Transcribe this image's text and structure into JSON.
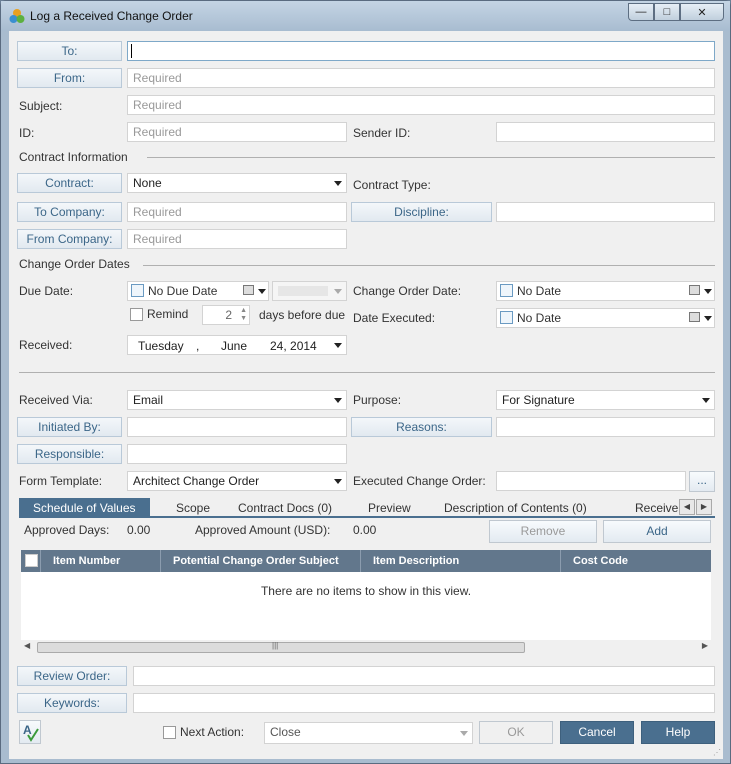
{
  "window": {
    "title": "Log a Received Change Order",
    "minimize": "—",
    "maximize": "□",
    "close": "✕"
  },
  "fields": {
    "to": {
      "label": "To:",
      "value": ""
    },
    "from": {
      "label": "From:",
      "placeholder": "Required"
    },
    "subject": {
      "label": "Subject:",
      "placeholder": "Required"
    },
    "id": {
      "label": "ID:",
      "placeholder": "Required"
    },
    "sender_id": {
      "label": "Sender ID:",
      "value": ""
    }
  },
  "contract_info": {
    "header": "Contract Information",
    "contract_label": "Contract:",
    "contract_value": "None",
    "contract_type_label": "Contract Type:",
    "to_company_label": "To Company:",
    "to_company_placeholder": "Required",
    "discipline_label": "Discipline:",
    "from_company_label": "From Company:",
    "from_company_placeholder": "Required"
  },
  "change_order_dates": {
    "header": "Change Order Dates",
    "due_date_label": "Due Date:",
    "no_due_date": "No Due Date",
    "remind_label": "Remind",
    "remind_value": "2",
    "days_before": "days before due",
    "change_order_date_label": "Change Order Date:",
    "change_order_date_value": "No Date",
    "date_executed_label": "Date Executed:",
    "date_executed_value": "No Date",
    "received_label": "Received:",
    "received_day": "Tuesday",
    "received_sep": ",",
    "received_month": "June",
    "received_date": "24, 2014"
  },
  "details": {
    "received_via_label": "Received Via:",
    "received_via_value": "Email",
    "purpose_label": "Purpose:",
    "purpose_value": "For Signature",
    "initiated_by_label": "Initiated By:",
    "reasons_label": "Reasons:",
    "responsible_label": "Responsible:",
    "form_template_label": "Form Template:",
    "form_template_value": "Architect Change Order",
    "executed_co_label": "Executed Change Order:",
    "browse": "..."
  },
  "tabs": [
    "Schedule of Values",
    "Scope",
    "Contract Docs (0)",
    "Preview",
    "Description of Contents (0)",
    "Receive"
  ],
  "sov": {
    "approved_days_label": "Approved Days:",
    "approved_days_value": "0.00",
    "approved_amount_label": "Approved Amount (USD):",
    "approved_amount_value": "0.00",
    "remove": "Remove",
    "add": "Add",
    "columns": [
      "Item Number",
      "Potential Change Order Subject",
      "Item Description",
      "Cost Code"
    ],
    "empty": "There are no items to show in this view."
  },
  "footer": {
    "review_order_label": "Review Order:",
    "keywords_label": "Keywords:",
    "next_action_label": "Next Action:",
    "next_action_value": "Close",
    "ok": "OK",
    "cancel": "Cancel",
    "help": "Help"
  }
}
